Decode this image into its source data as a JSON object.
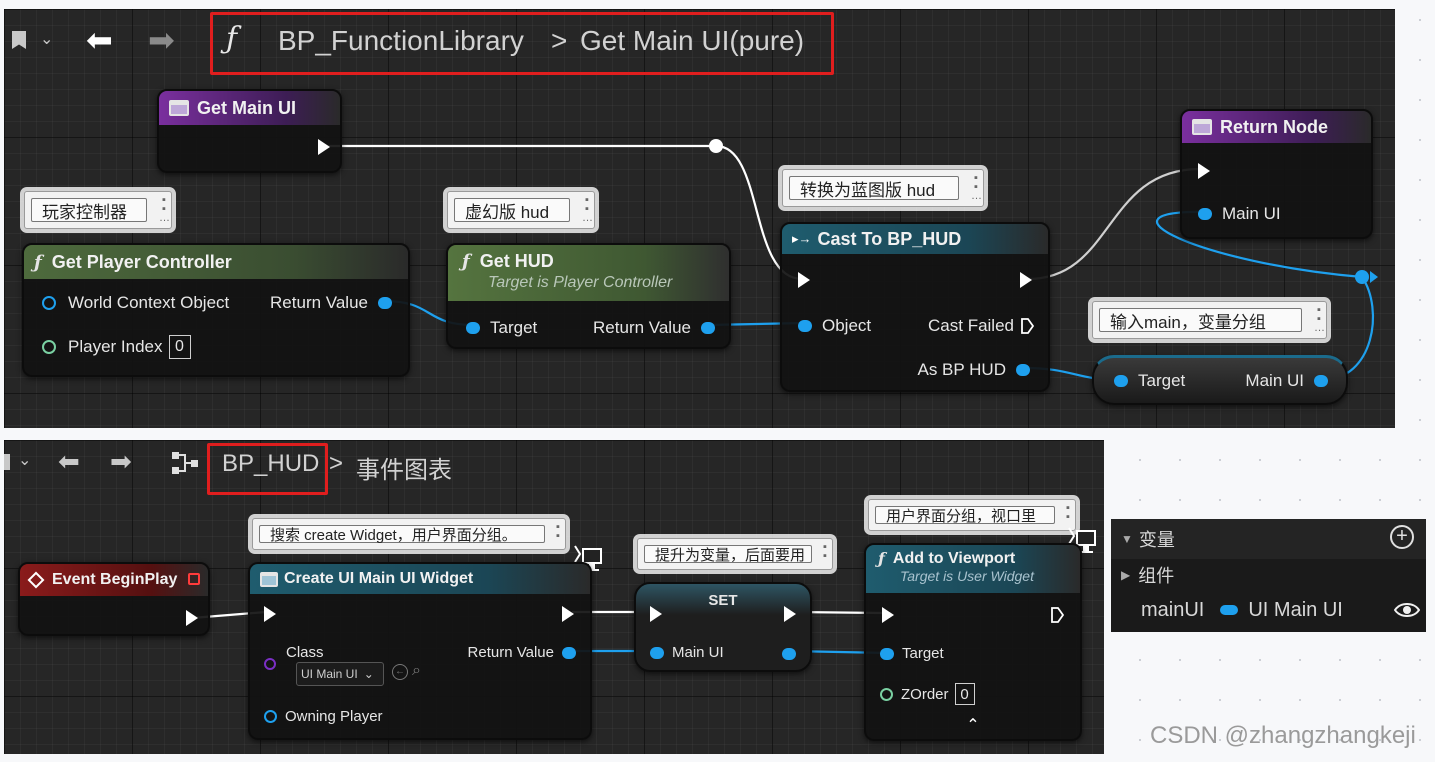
{
  "top_graph": {
    "breadcrumb": {
      "library": "BP_FunctionLibrary",
      "separator": ">",
      "function": "Get Main UI(pure)"
    },
    "nodes": {
      "get_main_ui": {
        "title": "Get Main UI"
      },
      "get_player_controller": {
        "title": "Get Player Controller",
        "pins": {
          "world_context": "World Context Object",
          "return_value": "Return Value",
          "player_index": "Player Index",
          "player_index_value": "0"
        }
      },
      "get_hud": {
        "title": "Get HUD",
        "subtitle": "Target is Player Controller",
        "pins": {
          "target": "Target",
          "return_value": "Return Value"
        }
      },
      "cast_to_bp_hud": {
        "title": "Cast To BP_HUD",
        "pins": {
          "object": "Object",
          "cast_failed": "Cast Failed",
          "as_bp_hud": "As BP HUD"
        }
      },
      "return_node": {
        "title": "Return Node",
        "pins": {
          "main_ui": "Main UI"
        }
      },
      "main_ui_getter": {
        "pins": {
          "target": "Target",
          "main_ui": "Main UI"
        }
      }
    },
    "comments": {
      "player_controller": "玩家控制器",
      "hud": "虚幻版 hud",
      "cast": "转换为蓝图版 hud",
      "getter": "输入main，变量分组"
    }
  },
  "bottom_graph": {
    "breadcrumb": {
      "blueprint": "BP_HUD",
      "separator": ">",
      "graph": "事件图表"
    },
    "nodes": {
      "event_begin_play": {
        "title": "Event BeginPlay"
      },
      "create_widget": {
        "title": "Create UI Main UI Widget",
        "pins": {
          "class": "Class",
          "class_value": "UI Main UI",
          "return_value": "Return Value",
          "owning_player": "Owning Player"
        }
      },
      "set": {
        "title": "SET",
        "pins": {
          "main_ui": "Main UI"
        }
      },
      "add_to_viewport": {
        "title": "Add to Viewport",
        "subtitle": "Target is User Widget",
        "pins": {
          "target": "Target",
          "zorder": "ZOrder",
          "zorder_value": "0"
        }
      }
    },
    "comments": {
      "create_widget": "搜索 create Widget，用户界面分组。",
      "set": "提升为变量，后面要用",
      "viewport": "用户界面分组，视口里"
    }
  },
  "variables_panel": {
    "header": "变量",
    "category": "组件",
    "variable_name": "mainUI",
    "variable_type": "UI Main UI"
  },
  "watermark": "CSDN @zhangzhangkeji",
  "colors": {
    "wire_blue": "#1ea0ee",
    "exec_white": "#ffffff",
    "pure_function_green": "#4e6b3d",
    "cast_teal": "#1f5c6e",
    "return_purple": "#5a2a7a",
    "event_red": "#7a1616",
    "highlight_red": "#e01e1e"
  }
}
